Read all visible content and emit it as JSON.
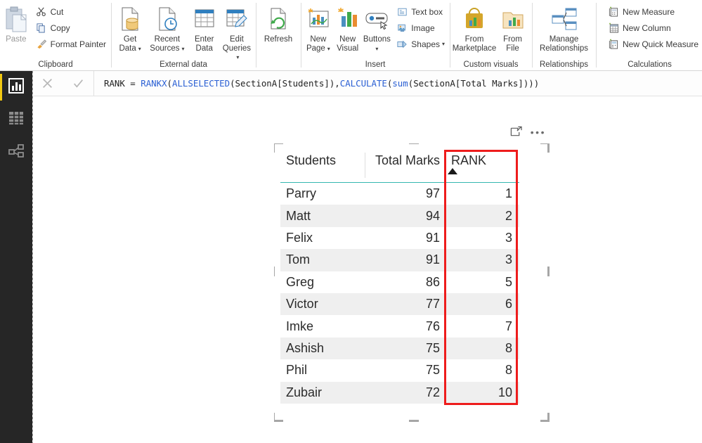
{
  "ribbon": {
    "groups": [
      {
        "label": "Clipboard",
        "paste": "Paste",
        "items": [
          {
            "label": "Cut",
            "icon": "scissors-icon"
          },
          {
            "label": "Copy",
            "icon": "copy-icon"
          },
          {
            "label": "Format Painter",
            "icon": "format-painter-icon"
          }
        ]
      },
      {
        "label": "External data",
        "items": [
          {
            "label": "Get\nData",
            "l1": "Get",
            "l2": "Data",
            "icon": "get-data-icon",
            "caret": true
          },
          {
            "label": "Recent Sources",
            "l1": "Recent",
            "l2": "Sources",
            "icon": "recent-sources-icon",
            "caret": true
          },
          {
            "label": "Enter Data",
            "l1": "Enter",
            "l2": "Data",
            "icon": "enter-data-icon",
            "caret": false
          },
          {
            "label": "Edit Queries",
            "l1": "Edit",
            "l2": "Queries",
            "icon": "edit-queries-icon",
            "caret": true
          },
          {
            "label": "Refresh",
            "l1": "Refresh",
            "l2": "",
            "icon": "refresh-icon",
            "caret": false
          }
        ]
      },
      {
        "label": "Insert",
        "items": [
          {
            "l1": "New",
            "l2": "Page",
            "icon": "new-page-icon",
            "caret": true
          },
          {
            "l1": "New",
            "l2": "Visual",
            "icon": "new-visual-icon",
            "caret": false
          },
          {
            "l1": "Buttons",
            "l2": "",
            "icon": "buttons-icon",
            "caret": true
          }
        ],
        "small": [
          {
            "label": "Text box",
            "icon": "text-box-icon",
            "caret": false
          },
          {
            "label": "Image",
            "icon": "image-icon",
            "caret": false
          },
          {
            "label": "Shapes",
            "icon": "shapes-icon",
            "caret": true
          }
        ]
      },
      {
        "label": "Custom visuals",
        "items": [
          {
            "l1": "From",
            "l2": "Marketplace",
            "icon": "marketplace-icon",
            "caret": false
          },
          {
            "l1": "From",
            "l2": "File",
            "icon": "from-file-icon",
            "caret": false
          }
        ]
      },
      {
        "label": "Relationships",
        "items": [
          {
            "l1": "Manage",
            "l2": "Relationships",
            "icon": "manage-relationships-icon",
            "caret": false
          }
        ]
      },
      {
        "label": "Calculations",
        "small": [
          {
            "label": "New Measure",
            "icon": "new-measure-icon",
            "caret": false
          },
          {
            "label": "New Column",
            "icon": "new-column-icon",
            "caret": false
          },
          {
            "label": "New Quick Measure",
            "icon": "new-quick-measure-icon",
            "caret": false
          }
        ]
      }
    ]
  },
  "formula_bar": {
    "cancel_icon": "cancel-icon",
    "confirm_icon": "confirm-icon",
    "measure_name": "RANK",
    "equals": " = ",
    "tokens": [
      {
        "t": "RANKX",
        "fn": true
      },
      {
        "t": "(",
        "fn": false
      },
      {
        "t": "ALLSELECTED",
        "fn": true
      },
      {
        "t": "(SectionA[Students]),",
        "fn": false
      },
      {
        "t": "CALCULATE",
        "fn": true
      },
      {
        "t": "(",
        "fn": false
      },
      {
        "t": "sum",
        "fn": true
      },
      {
        "t": "(SectionA[Total Marks])))",
        "fn": false
      }
    ],
    "full_text": "RANK = RANKX(ALLSELECTED(SectionA[Students]),CALCULATE(sum(SectionA[Total Marks])))"
  },
  "left_nav": {
    "items": [
      {
        "name": "report-view",
        "icon": "bar-chart-icon",
        "selected": true
      },
      {
        "name": "data-view",
        "icon": "table-grid-icon",
        "selected": false
      },
      {
        "name": "model-view",
        "icon": "relationships-icon",
        "selected": false
      }
    ],
    "accent_color": "#f2c811"
  },
  "visual": {
    "focus_icon": "focus-mode-icon",
    "more_icon": "more-options-icon",
    "highlight_color": "#ee1c1c",
    "header_rule_color": "#35b8b1",
    "sort_indicator": "sort-ascending-icon",
    "sorted_column": "RANK"
  },
  "chart_data": {
    "type": "table",
    "title": "",
    "columns": [
      "Students",
      "Total Marks",
      "RANK"
    ],
    "rows": [
      {
        "Students": "Parry",
        "Total Marks": "97",
        "RANK": "1"
      },
      {
        "Students": "Matt",
        "Total Marks": "94",
        "RANK": "2"
      },
      {
        "Students": "Felix",
        "Total Marks": "91",
        "RANK": "3"
      },
      {
        "Students": "Tom",
        "Total Marks": "91",
        "RANK": "3"
      },
      {
        "Students": "Greg",
        "Total Marks": "86",
        "RANK": "5"
      },
      {
        "Students": "Victor",
        "Total Marks": "77",
        "RANK": "6"
      },
      {
        "Students": "Imke",
        "Total Marks": "76",
        "RANK": "7"
      },
      {
        "Students": "Ashish",
        "Total Marks": "75",
        "RANK": "8"
      },
      {
        "Students": "Phil",
        "Total Marks": "75",
        "RANK": "8"
      },
      {
        "Students": "Zubair",
        "Total Marks": "72",
        "RANK": "10"
      }
    ]
  }
}
